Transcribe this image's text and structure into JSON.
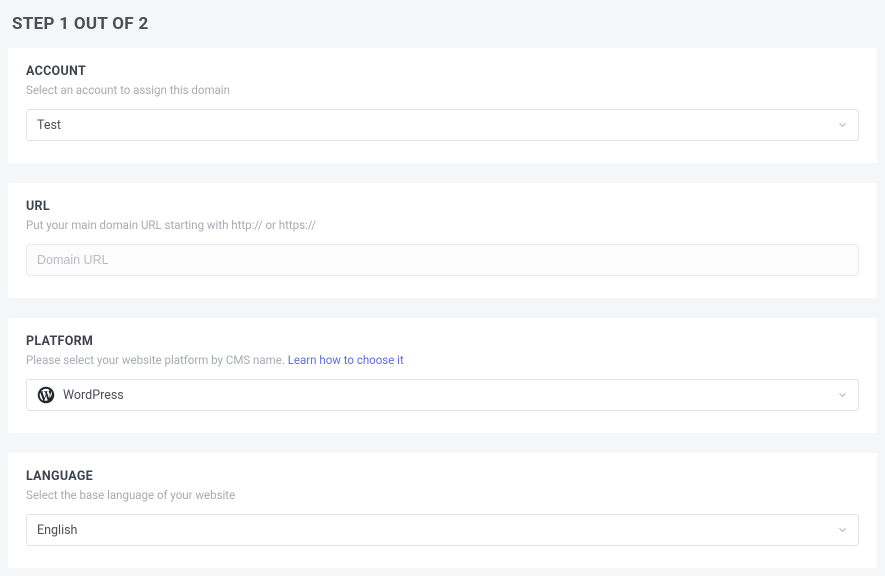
{
  "page": {
    "title": "STEP 1 OUT OF 2"
  },
  "account": {
    "title": "ACCOUNT",
    "help": "Select an account to assign this domain",
    "selected": "Test"
  },
  "url": {
    "title": "URL",
    "help": "Put your main domain URL starting with http:// or https://",
    "placeholder": "Domain URL",
    "value": ""
  },
  "platform": {
    "title": "PLATFORM",
    "help_prefix": "Please select your website platform by CMS name. ",
    "help_link_label": "Learn how to choose it",
    "selected": "WordPress",
    "icon": "wordpress-icon"
  },
  "language": {
    "title": "LANGUAGE",
    "help": "Select the base language of your website",
    "selected": "English"
  }
}
